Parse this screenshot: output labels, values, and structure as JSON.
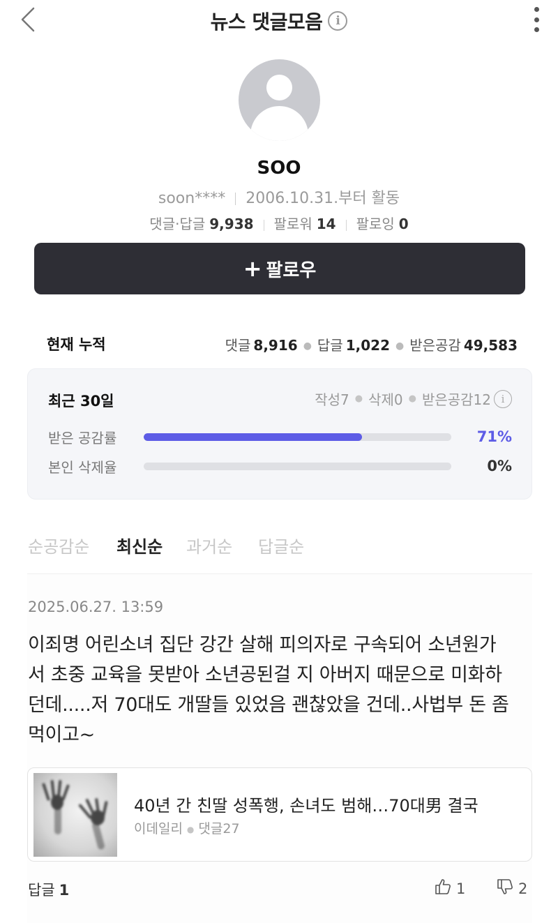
{
  "header": {
    "title": "뉴스 댓글모음",
    "info_glyph": "i",
    "icons": {
      "back": "back-chevron-icon",
      "more": "more-vertical-icon"
    }
  },
  "profile": {
    "nickname": "SOO",
    "user_id": "soon****",
    "since": "2006.10.31.부터 활동",
    "stats": {
      "comments_label": "댓글·답글",
      "comments_value": "9,938",
      "followers_label": "팔로워",
      "followers_value": "14",
      "following_label": "팔로잉",
      "following_value": "0"
    },
    "follow_button": {
      "plus": "+",
      "label": "팔로우"
    }
  },
  "cumulative": {
    "title": "현재 누적",
    "comment_label": "댓글",
    "comment_value": "8,916",
    "reply_label": "답글",
    "reply_value": "1,022",
    "likes_label": "받은공감",
    "likes_value": "49,583"
  },
  "recent": {
    "title": "최근 30일",
    "written": "작성7",
    "deleted": "삭제0",
    "received": "받은공감12",
    "bars": [
      {
        "label": "받은 공감률",
        "value": "71%",
        "fraction": 0.71,
        "color": "#5d5ce6"
      },
      {
        "label": "본인 삭제율",
        "value": "0%",
        "fraction": 0.0,
        "color": "#5d5ce6"
      }
    ]
  },
  "sort_tabs": [
    "순공감순",
    "최신순",
    "과거순",
    "답글순"
  ],
  "active_sort": "최신순",
  "comment": {
    "date": "2025.06.27. 13:59",
    "text": "이죄명 어린소녀 집단 강간 살해 피의자로 구속되어 소년원가서 초중 교육을 못받아 소년공된걸 지 아버지 때문으로 미화하던데.....저 70대도 개딸들 있었음 괜찮았을 건데..사법부 돈 좀 먹이고~",
    "news": {
      "title": "40년 간 친딸 성폭행, 손녀도 범해…70대男 결국",
      "source": "이데일리",
      "comments": "댓글27"
    },
    "reply_label": "답글",
    "reply_count": "1",
    "likes": "1",
    "dislikes": "2"
  }
}
